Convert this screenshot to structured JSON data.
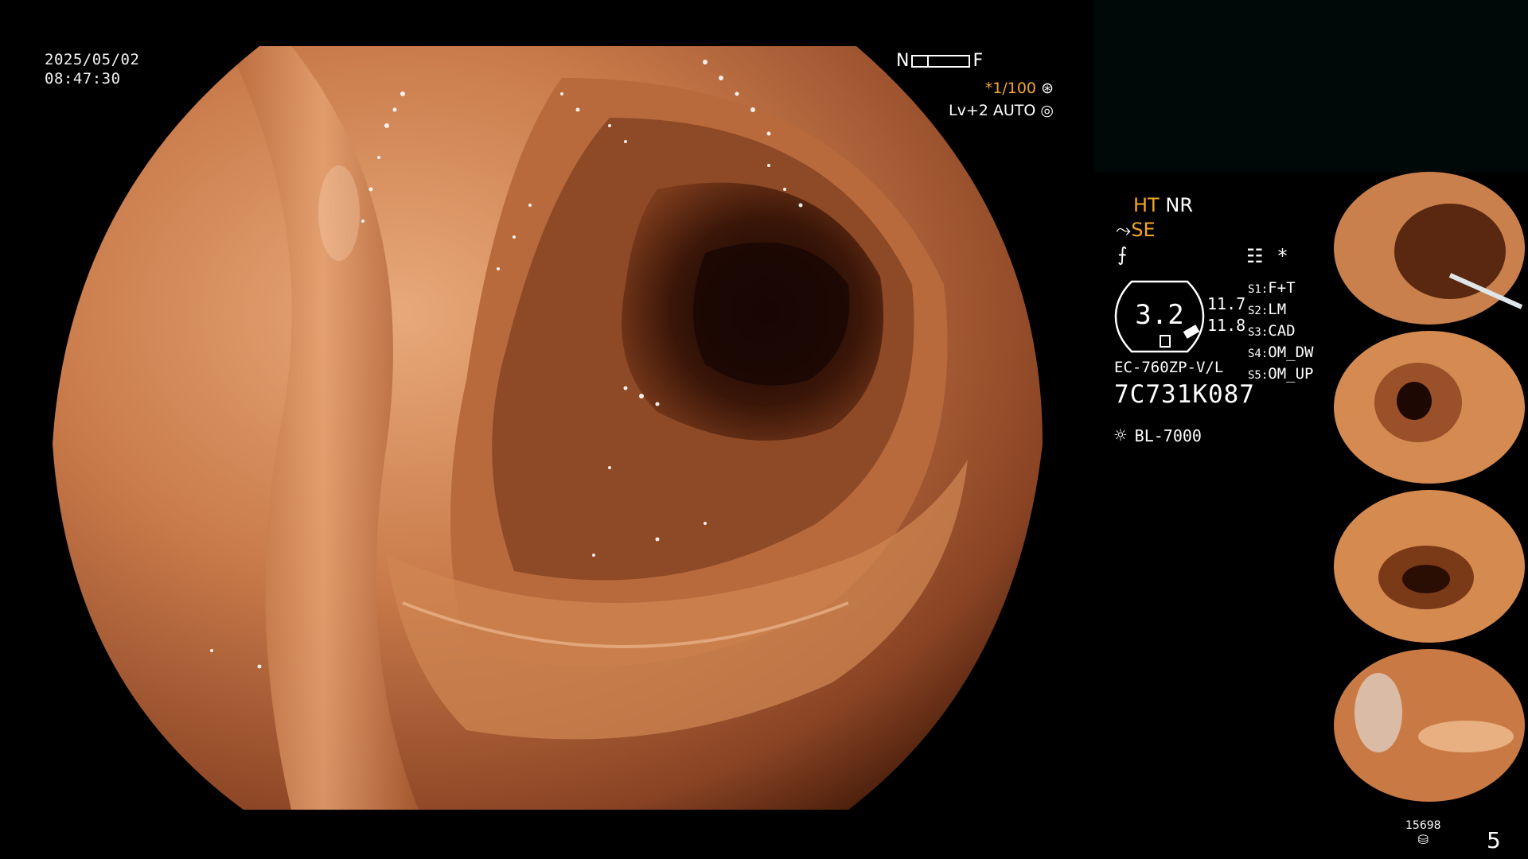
{
  "overlay": {
    "date": "2025/05/02",
    "time": "08:47:30",
    "scale_left": "N",
    "scale_right": "F",
    "shutter": "*1/100",
    "light_level": "Lv+2",
    "light_mode": "AUTO"
  },
  "side_panel": {
    "ht": "HT",
    "nr": "NR",
    "se": "SE",
    "gauge_value": "3.2",
    "readout_1": "11.7",
    "readout_2": "11.8",
    "scope_model": "EC-760ZP-V/L",
    "serial": "7C731K087",
    "light_source": "BL-7000",
    "star": "*",
    "s_functions": [
      {
        "key": "S1:",
        "value": "F+T"
      },
      {
        "key": "S2:",
        "value": "LM"
      },
      {
        "key": "S3:",
        "value": "CAD"
      },
      {
        "key": "S4:",
        "value": "OM_DW"
      },
      {
        "key": "S5:",
        "value": "OM_UP"
      }
    ]
  },
  "footer": {
    "image_count": "15698",
    "page": "5"
  },
  "colors": {
    "background": "#000000",
    "tissue": "#c97a4a",
    "accent": "#f5a623"
  }
}
